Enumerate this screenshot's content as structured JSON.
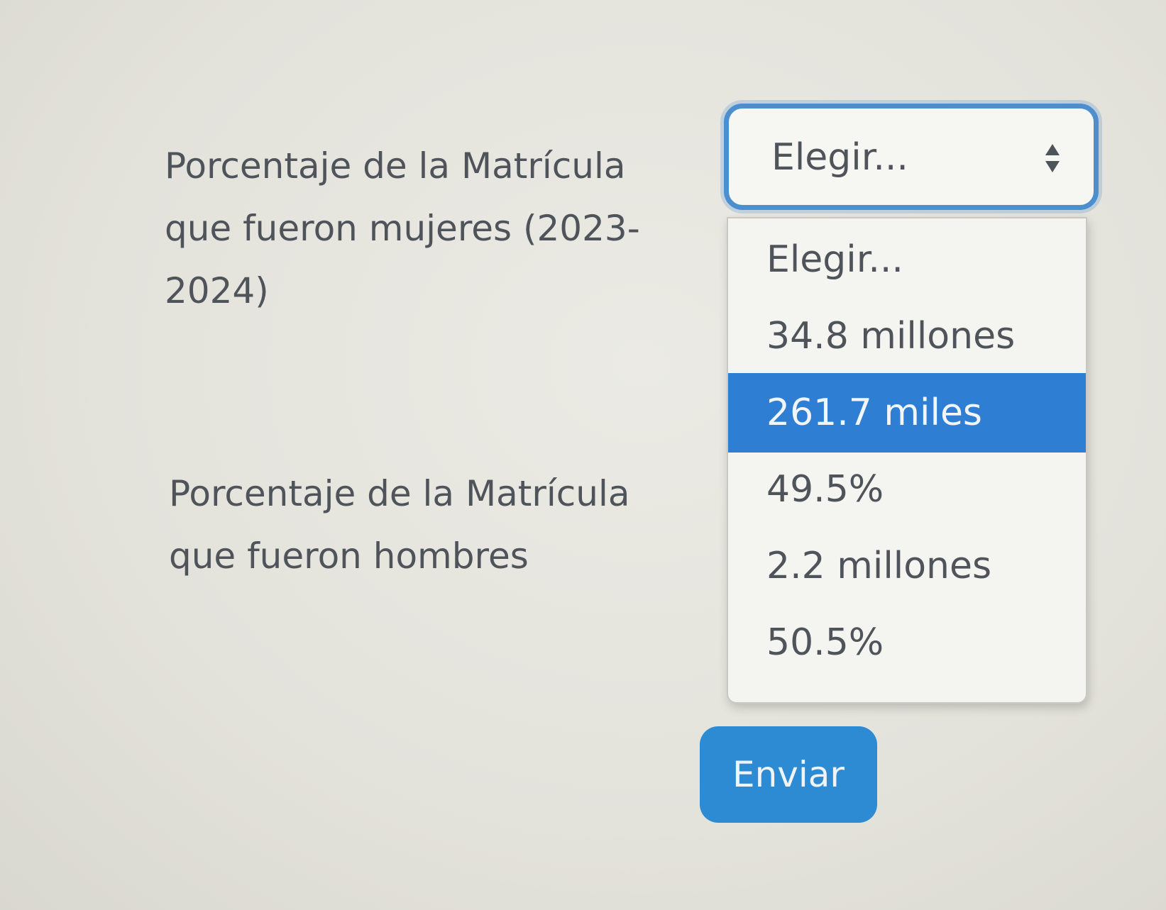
{
  "form": {
    "question_women": "Porcentaje de la Matrícula que fueron mujeres  (2023-2024)",
    "question_men": "Porcentaje de la Matrícula que fueron hombres",
    "select": {
      "current_value": "Elegir...",
      "options": [
        {
          "label": "Elegir...",
          "selected": false
        },
        {
          "label": "34.8 millones",
          "selected": false
        },
        {
          "label": "261.7 miles",
          "selected": true
        },
        {
          "label": "49.5%",
          "selected": false
        },
        {
          "label": "2.2 millones",
          "selected": false
        },
        {
          "label": "50.5%",
          "selected": false
        }
      ]
    },
    "submit_label": "Enviar"
  },
  "colors": {
    "accent": "#2e7fd3",
    "button": "#2d8bd4",
    "focus_border": "#4d8fce",
    "text": "#4f545a",
    "background": "#e3e2db"
  },
  "icons": {
    "select_arrows": "updown-caret-icon"
  }
}
